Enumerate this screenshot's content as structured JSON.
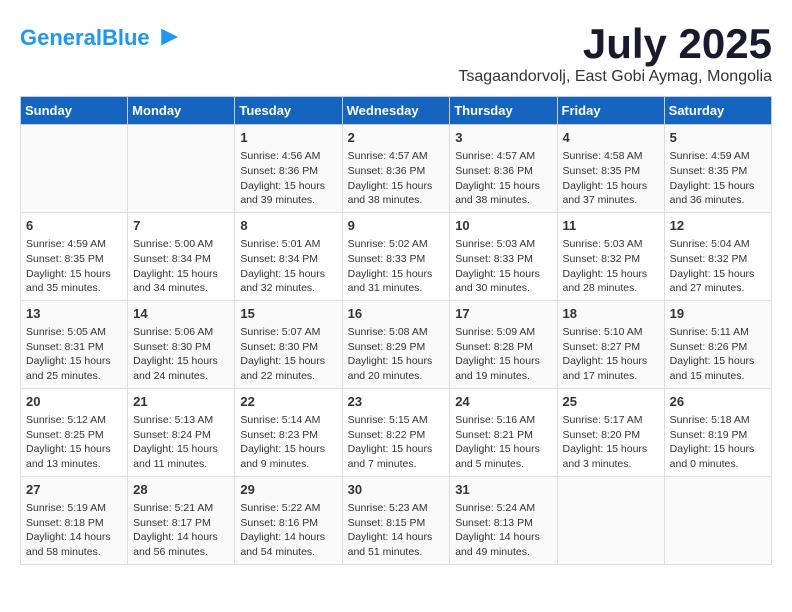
{
  "header": {
    "logo_general": "General",
    "logo_blue": "Blue",
    "main_title": "July 2025",
    "subtitle": "Tsagaandorvolj, East Gobi Aymag, Mongolia"
  },
  "days_of_week": [
    "Sunday",
    "Monday",
    "Tuesday",
    "Wednesday",
    "Thursday",
    "Friday",
    "Saturday"
  ],
  "weeks": [
    [
      {
        "day": "",
        "detail": ""
      },
      {
        "day": "",
        "detail": ""
      },
      {
        "day": "1",
        "detail": "Sunrise: 4:56 AM\nSunset: 8:36 PM\nDaylight: 15 hours and 39 minutes."
      },
      {
        "day": "2",
        "detail": "Sunrise: 4:57 AM\nSunset: 8:36 PM\nDaylight: 15 hours and 38 minutes."
      },
      {
        "day": "3",
        "detail": "Sunrise: 4:57 AM\nSunset: 8:36 PM\nDaylight: 15 hours and 38 minutes."
      },
      {
        "day": "4",
        "detail": "Sunrise: 4:58 AM\nSunset: 8:35 PM\nDaylight: 15 hours and 37 minutes."
      },
      {
        "day": "5",
        "detail": "Sunrise: 4:59 AM\nSunset: 8:35 PM\nDaylight: 15 hours and 36 minutes."
      }
    ],
    [
      {
        "day": "6",
        "detail": "Sunrise: 4:59 AM\nSunset: 8:35 PM\nDaylight: 15 hours and 35 minutes."
      },
      {
        "day": "7",
        "detail": "Sunrise: 5:00 AM\nSunset: 8:34 PM\nDaylight: 15 hours and 34 minutes."
      },
      {
        "day": "8",
        "detail": "Sunrise: 5:01 AM\nSunset: 8:34 PM\nDaylight: 15 hours and 32 minutes."
      },
      {
        "day": "9",
        "detail": "Sunrise: 5:02 AM\nSunset: 8:33 PM\nDaylight: 15 hours and 31 minutes."
      },
      {
        "day": "10",
        "detail": "Sunrise: 5:03 AM\nSunset: 8:33 PM\nDaylight: 15 hours and 30 minutes."
      },
      {
        "day": "11",
        "detail": "Sunrise: 5:03 AM\nSunset: 8:32 PM\nDaylight: 15 hours and 28 minutes."
      },
      {
        "day": "12",
        "detail": "Sunrise: 5:04 AM\nSunset: 8:32 PM\nDaylight: 15 hours and 27 minutes."
      }
    ],
    [
      {
        "day": "13",
        "detail": "Sunrise: 5:05 AM\nSunset: 8:31 PM\nDaylight: 15 hours and 25 minutes."
      },
      {
        "day": "14",
        "detail": "Sunrise: 5:06 AM\nSunset: 8:30 PM\nDaylight: 15 hours and 24 minutes."
      },
      {
        "day": "15",
        "detail": "Sunrise: 5:07 AM\nSunset: 8:30 PM\nDaylight: 15 hours and 22 minutes."
      },
      {
        "day": "16",
        "detail": "Sunrise: 5:08 AM\nSunset: 8:29 PM\nDaylight: 15 hours and 20 minutes."
      },
      {
        "day": "17",
        "detail": "Sunrise: 5:09 AM\nSunset: 8:28 PM\nDaylight: 15 hours and 19 minutes."
      },
      {
        "day": "18",
        "detail": "Sunrise: 5:10 AM\nSunset: 8:27 PM\nDaylight: 15 hours and 17 minutes."
      },
      {
        "day": "19",
        "detail": "Sunrise: 5:11 AM\nSunset: 8:26 PM\nDaylight: 15 hours and 15 minutes."
      }
    ],
    [
      {
        "day": "20",
        "detail": "Sunrise: 5:12 AM\nSunset: 8:25 PM\nDaylight: 15 hours and 13 minutes."
      },
      {
        "day": "21",
        "detail": "Sunrise: 5:13 AM\nSunset: 8:24 PM\nDaylight: 15 hours and 11 minutes."
      },
      {
        "day": "22",
        "detail": "Sunrise: 5:14 AM\nSunset: 8:23 PM\nDaylight: 15 hours and 9 minutes."
      },
      {
        "day": "23",
        "detail": "Sunrise: 5:15 AM\nSunset: 8:22 PM\nDaylight: 15 hours and 7 minutes."
      },
      {
        "day": "24",
        "detail": "Sunrise: 5:16 AM\nSunset: 8:21 PM\nDaylight: 15 hours and 5 minutes."
      },
      {
        "day": "25",
        "detail": "Sunrise: 5:17 AM\nSunset: 8:20 PM\nDaylight: 15 hours and 3 minutes."
      },
      {
        "day": "26",
        "detail": "Sunrise: 5:18 AM\nSunset: 8:19 PM\nDaylight: 15 hours and 0 minutes."
      }
    ],
    [
      {
        "day": "27",
        "detail": "Sunrise: 5:19 AM\nSunset: 8:18 PM\nDaylight: 14 hours and 58 minutes."
      },
      {
        "day": "28",
        "detail": "Sunrise: 5:21 AM\nSunset: 8:17 PM\nDaylight: 14 hours and 56 minutes."
      },
      {
        "day": "29",
        "detail": "Sunrise: 5:22 AM\nSunset: 8:16 PM\nDaylight: 14 hours and 54 minutes."
      },
      {
        "day": "30",
        "detail": "Sunrise: 5:23 AM\nSunset: 8:15 PM\nDaylight: 14 hours and 51 minutes."
      },
      {
        "day": "31",
        "detail": "Sunrise: 5:24 AM\nSunset: 8:13 PM\nDaylight: 14 hours and 49 minutes."
      },
      {
        "day": "",
        "detail": ""
      },
      {
        "day": "",
        "detail": ""
      }
    ]
  ]
}
